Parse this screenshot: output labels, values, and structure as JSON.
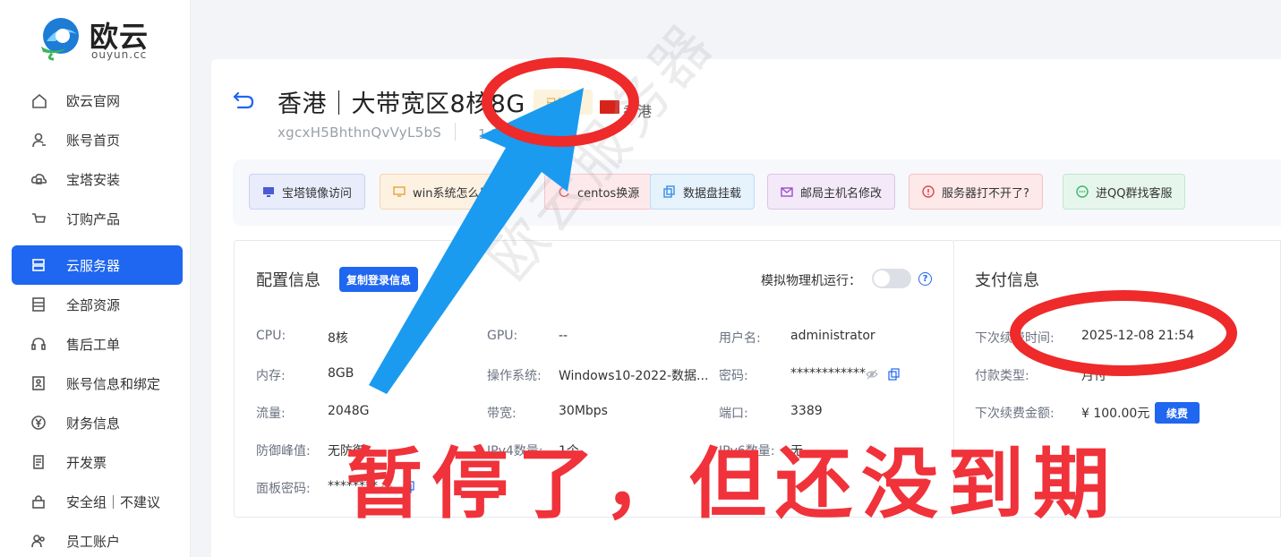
{
  "brand": {
    "name": "欧云",
    "domain": "ouyun.cc"
  },
  "sidebar": {
    "items": [
      {
        "label": "欧云官网",
        "icon": "home-icon"
      },
      {
        "label": "账号首页",
        "icon": "user-icon"
      },
      {
        "label": "宝塔安装",
        "icon": "cloud-box-icon"
      },
      {
        "label": "订购产品",
        "icon": "cart-icon"
      },
      {
        "label": "云服务器",
        "icon": "server-icon",
        "active": true
      },
      {
        "label": "全部资源",
        "icon": "stack-icon"
      },
      {
        "label": "售后工单",
        "icon": "headset-icon"
      },
      {
        "label": "账号信息和绑定",
        "icon": "id-card-icon"
      },
      {
        "label": "财务信息",
        "icon": "yen-icon"
      },
      {
        "label": "开发票",
        "icon": "document-icon"
      },
      {
        "label": "安全组｜不建议",
        "icon": "lock-icon"
      },
      {
        "label": "员工账户",
        "icon": "team-icon"
      }
    ]
  },
  "server": {
    "title": "香港｜大带宽区8核8G",
    "status": "已暂停",
    "region": "香港",
    "instance_id": "xgcxH5BhthnQvVyL5bS",
    "ip": "1   2.81   9  宽"
  },
  "quick_actions": [
    {
      "label": "宝塔镜像访问",
      "bg": "#e8ecfb",
      "border": "#c9d2f3",
      "icon_color": "#4a5bd4",
      "icon": "monitor-icon"
    },
    {
      "label": "win系统怎么用",
      "bg": "#fdf1e2",
      "border": "#f5d7b0",
      "icon_color": "#e6a23c",
      "icon": "desktop-icon"
    },
    {
      "label": "centos换源",
      "bg": "#fde9ec",
      "border": "#f5c4cc",
      "icon_color": "#e05b6d",
      "icon": "refresh-icon"
    },
    {
      "label": "数据盘挂载",
      "bg": "#e6f2fc",
      "border": "#bfdcf4",
      "icon_color": "#3a8ee6",
      "icon": "copy-icon"
    },
    {
      "label": "邮局主机名修改",
      "bg": "#f3e9f8",
      "border": "#dcc4ea",
      "icon_color": "#9b4fc9",
      "icon": "mail-icon"
    },
    {
      "label": "服务器打不开了?",
      "bg": "#fde9ea",
      "border": "#f5c2c5",
      "icon_color": "#e04848",
      "icon": "alert-icon"
    },
    {
      "label": "进QQ群找客服",
      "bg": "#e7f6ec",
      "border": "#c2e7cf",
      "icon_color": "#3bb46b",
      "icon": "chat-icon"
    }
  ],
  "config": {
    "title": "配置信息",
    "copy_label": "复制登录信息",
    "toggle_label": "模拟物理机运行：",
    "rows": [
      [
        {
          "label": "CPU:",
          "value": "8核"
        },
        {
          "label": "GPU:",
          "value": "--"
        },
        {
          "label": "用户名:",
          "value": "administrator"
        }
      ],
      [
        {
          "label": "内存:",
          "value": "8GB"
        },
        {
          "label": "操作系统:",
          "value": "Windows10-2022-数据..."
        },
        {
          "label": "密码:",
          "value": "************"
        }
      ],
      [
        {
          "label": "流量:",
          "value": "2048G"
        },
        {
          "label": "带宽:",
          "value": "30Mbps"
        },
        {
          "label": "端口:",
          "value": "3389"
        }
      ],
      [
        {
          "label": "防御峰值:",
          "value": "无防御"
        },
        {
          "label": "IPv4数量:",
          "value": "1个"
        },
        {
          "label": "IPv6数量:",
          "value": "无"
        }
      ],
      [
        {
          "label": "面板密码:",
          "value": "********"
        }
      ]
    ]
  },
  "payment": {
    "title": "支付信息",
    "rows": [
      {
        "label": "下次续费时间:",
        "value": "2025-12-08 21:54"
      },
      {
        "label": "付款类型:",
        "value": "月付"
      },
      {
        "label": "下次续费金额:",
        "value": "¥ 100.00元"
      }
    ],
    "renew_label": "续费"
  },
  "overlay": {
    "watermark": "欧云服务器",
    "note": "暂停了，但还没到期",
    "colors": {
      "arrow": "#1a9bf0",
      "ellipse": "#ee2a2a",
      "note": "#f0323a"
    }
  }
}
